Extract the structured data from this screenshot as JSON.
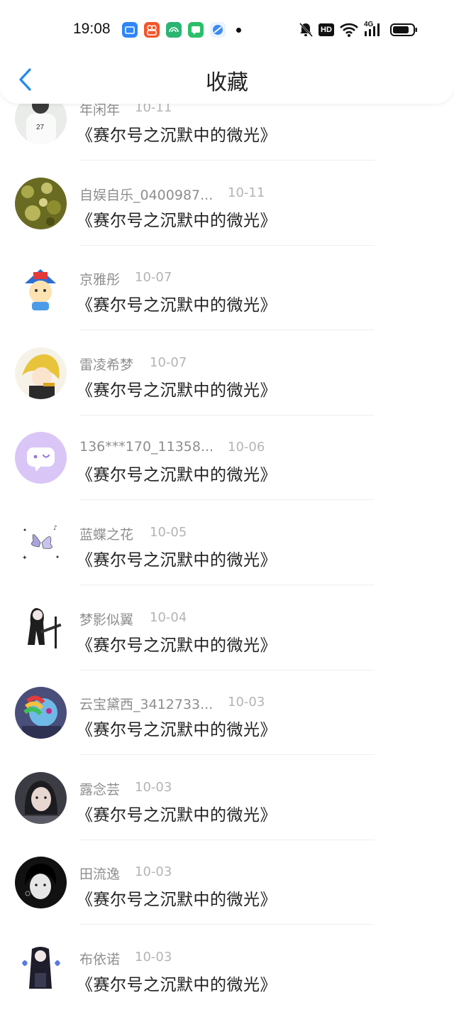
{
  "status_bar": {
    "time": "19:08",
    "notification_icons": [
      "mail-app-icon",
      "video-app-icon",
      "wallet-app-icon",
      "messages-app-icon",
      "browser-app-icon"
    ],
    "hd_label": "HD",
    "network_label": "4G"
  },
  "header": {
    "back_icon": "chevron-left-icon",
    "title": "收藏"
  },
  "colors": {
    "accent": "#1e8bf0",
    "text_primary": "#222222",
    "text_secondary": "#8e8e8e",
    "text_date": "#b4b4b4",
    "divider": "#efefef"
  },
  "items": [
    {
      "username": "年闲年",
      "date": "10-11",
      "title": "《赛尔号之沉默中的微光》",
      "avatar": "anime-boy-white-shirt"
    },
    {
      "username": "自娱自乐_0400987...",
      "date": "10-11",
      "title": "《赛尔号之沉默中的微光》",
      "avatar": "green-pattern"
    },
    {
      "username": "京雅彤",
      "date": "10-07",
      "title": "《赛尔号之沉默中的微光》",
      "avatar": "cartoon-kid-hat"
    },
    {
      "username": "雷凌希梦",
      "date": "10-07",
      "title": "《赛尔号之沉默中的微光》",
      "avatar": "anime-blonde"
    },
    {
      "username": "136***170_11358...",
      "date": "10-06",
      "title": "《赛尔号之沉默中的微光》",
      "avatar": "default-chat-bubble"
    },
    {
      "username": "蓝蝶之花",
      "date": "10-05",
      "title": "《赛尔号之沉默中的微光》",
      "avatar": "butterfly-sketch"
    },
    {
      "username": "梦影似翼",
      "date": "10-04",
      "title": "《赛尔号之沉默中的微光》",
      "avatar": "anime-guitar-silhouette"
    },
    {
      "username": "云宝黛西_3412733...",
      "date": "10-03",
      "title": "《赛尔号之沉默中的微光》",
      "avatar": "rainbow-pony"
    },
    {
      "username": "露念芸",
      "date": "10-03",
      "title": "《赛尔号之沉默中的微光》",
      "avatar": "girl-photo"
    },
    {
      "username": "田流逸",
      "date": "10-03",
      "title": "《赛尔号之沉默中的微光》",
      "avatar": "bw-portrait"
    },
    {
      "username": "布依诺",
      "date": "10-03",
      "title": "《赛尔号之沉默中的微光》",
      "avatar": "anime-dark-robe"
    }
  ]
}
